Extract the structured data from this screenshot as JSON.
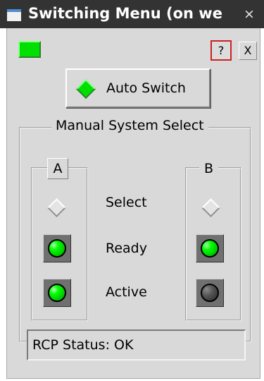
{
  "window": {
    "title": "Switching Menu (on we",
    "close_glyph": "×"
  },
  "toolbar": {
    "status_color": "#00e000",
    "help_label": "?",
    "close_label": "X"
  },
  "auto_switch": {
    "label": "Auto Switch",
    "indicator_color": "#00e000"
  },
  "manual_select": {
    "title": "Manual System Select",
    "row_labels": {
      "select": "Select",
      "ready": "Ready",
      "active": "Active"
    },
    "systems": [
      {
        "name": "A",
        "selected": false,
        "ready": "on",
        "active": "on"
      },
      {
        "name": "B",
        "selected": false,
        "ready": "on",
        "active": "off"
      }
    ]
  },
  "status": {
    "text": "RCP Status: OK"
  },
  "colors": {
    "lamp_on": "#00e000",
    "lamp_off": "#444444",
    "panel_bg": "#d9d9d9",
    "titlebar_bg": "#333333"
  }
}
